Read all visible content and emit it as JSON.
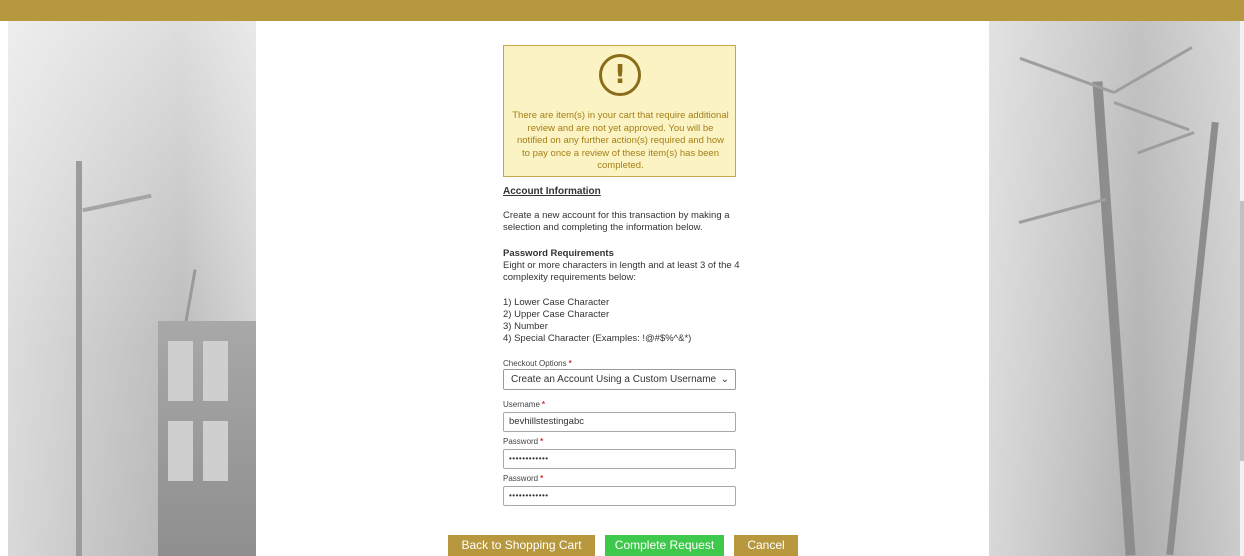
{
  "colors": {
    "brand_gold": "#b8983e",
    "alert_bg": "#fbf3c4",
    "alert_text": "#a57f16",
    "success_green": "#3ec84c",
    "required_red": "#d03030"
  },
  "alert": {
    "icon": "exclamation-circle-icon",
    "icon_glyph": "!",
    "message": "There are item(s) in your cart that require additional review and are not yet approved. You will be notified on any further action(s) required and how to pay once a review of these item(s) has been completed."
  },
  "account": {
    "title": "Account Information",
    "description": "Create a new account for this transaction by making a selection and completing the information below.",
    "password_requirements_title": "Password Requirements",
    "password_requirements_desc": "Eight or more characters in length and at least 3 of the 4 complexity requirements below:",
    "requirements": [
      "1) Lower Case Character",
      "2) Upper Case Character",
      "3) Number",
      "4) Special Character (Examples: !@#$%^&*)"
    ]
  },
  "form": {
    "required_mark": "*",
    "checkout_options_label": "Checkout Options",
    "checkout_options_value": "Create an Account Using a Custom Username",
    "username_label": "Username",
    "username_value": "bevhillstestingabc",
    "password_label": "Password",
    "password_value": "••••••••••••",
    "password_confirm_label": "Password",
    "password_confirm_value": "••••••••••••"
  },
  "buttons": {
    "back": "Back to Shopping Cart",
    "complete": "Complete Request",
    "cancel": "Cancel"
  }
}
